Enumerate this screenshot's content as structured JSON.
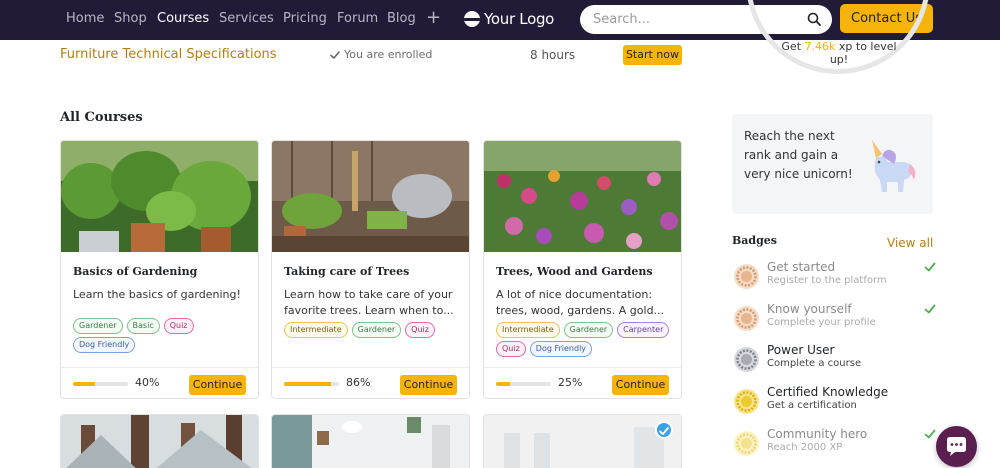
{
  "nav": {
    "items": [
      "Home",
      "Shop",
      "Courses",
      "Services",
      "Pricing",
      "Forum",
      "Blog"
    ],
    "active": "Courses",
    "plus": "+",
    "logo": "Your Logo",
    "search_placeholder": "Search...",
    "contact": "Contact Us"
  },
  "enrolled": {
    "title": "Furniture Technical Specifications",
    "status": "You are enrolled",
    "hours": "8 hours",
    "start": "Start now"
  },
  "xp": {
    "prefix": "Get",
    "value": "7.46k",
    "suffix": "xp to level up!"
  },
  "unicorn": {
    "text": "Reach the next rank and gain a very nice unicorn!"
  },
  "badges": {
    "title": "Badges",
    "view_all": "View all",
    "items": [
      {
        "name": "Get started",
        "sub": "Register to the platform",
        "status": "done",
        "medal": "bronze"
      },
      {
        "name": "Know yourself",
        "sub": "Complete your profile",
        "status": "done",
        "medal": "bronze"
      },
      {
        "name": "Power User",
        "sub": "Complete a course",
        "status": "earned",
        "medal": "silver"
      },
      {
        "name": "Certified Knowledge",
        "sub": "Get a certification",
        "status": "earned",
        "medal": "gold"
      },
      {
        "name": "Community hero",
        "sub": "Reach 2000 XP",
        "status": "done",
        "medal": "gold-light"
      }
    ]
  },
  "courses": {
    "title": "All Courses",
    "continue": "Continue",
    "items": [
      {
        "title": "Basics of Gardening",
        "desc": "Learn the basics of gardening!",
        "tags": [
          {
            "label": "Gardener",
            "color": "green"
          },
          {
            "label": "Basic",
            "color": "green"
          },
          {
            "label": "Quiz",
            "color": "pink"
          },
          {
            "label": "Dog Friendly",
            "color": "blue"
          }
        ],
        "progress": 0.4,
        "progress_label": "40%"
      },
      {
        "title": "Taking care of Trees",
        "desc": "Learn how to take care of your favorite trees. Learn when to...",
        "tags": [
          {
            "label": "Intermediate",
            "color": "yellow"
          },
          {
            "label": "Gardener",
            "color": "green"
          },
          {
            "label": "Quiz",
            "color": "pink"
          }
        ],
        "progress": 0.86,
        "progress_label": "86%"
      },
      {
        "title": "Trees, Wood and Gardens",
        "desc": "A lot of nice documentation: trees, wood, gardens. A gold...",
        "tags": [
          {
            "label": "Intermediate",
            "color": "yellow"
          },
          {
            "label": "Gardener",
            "color": "green"
          },
          {
            "label": "Carpenter",
            "color": "purple"
          },
          {
            "label": "Quiz",
            "color": "pink"
          },
          {
            "label": "Dog Friendly",
            "color": "blue"
          }
        ],
        "progress": 0.25,
        "progress_label": "25%"
      }
    ]
  },
  "colors": {
    "nav_bg": "#221b38",
    "accent": "#f6b40a",
    "link": "#b27e13",
    "check": "#4caf50",
    "chat": "#5a1f4f"
  }
}
